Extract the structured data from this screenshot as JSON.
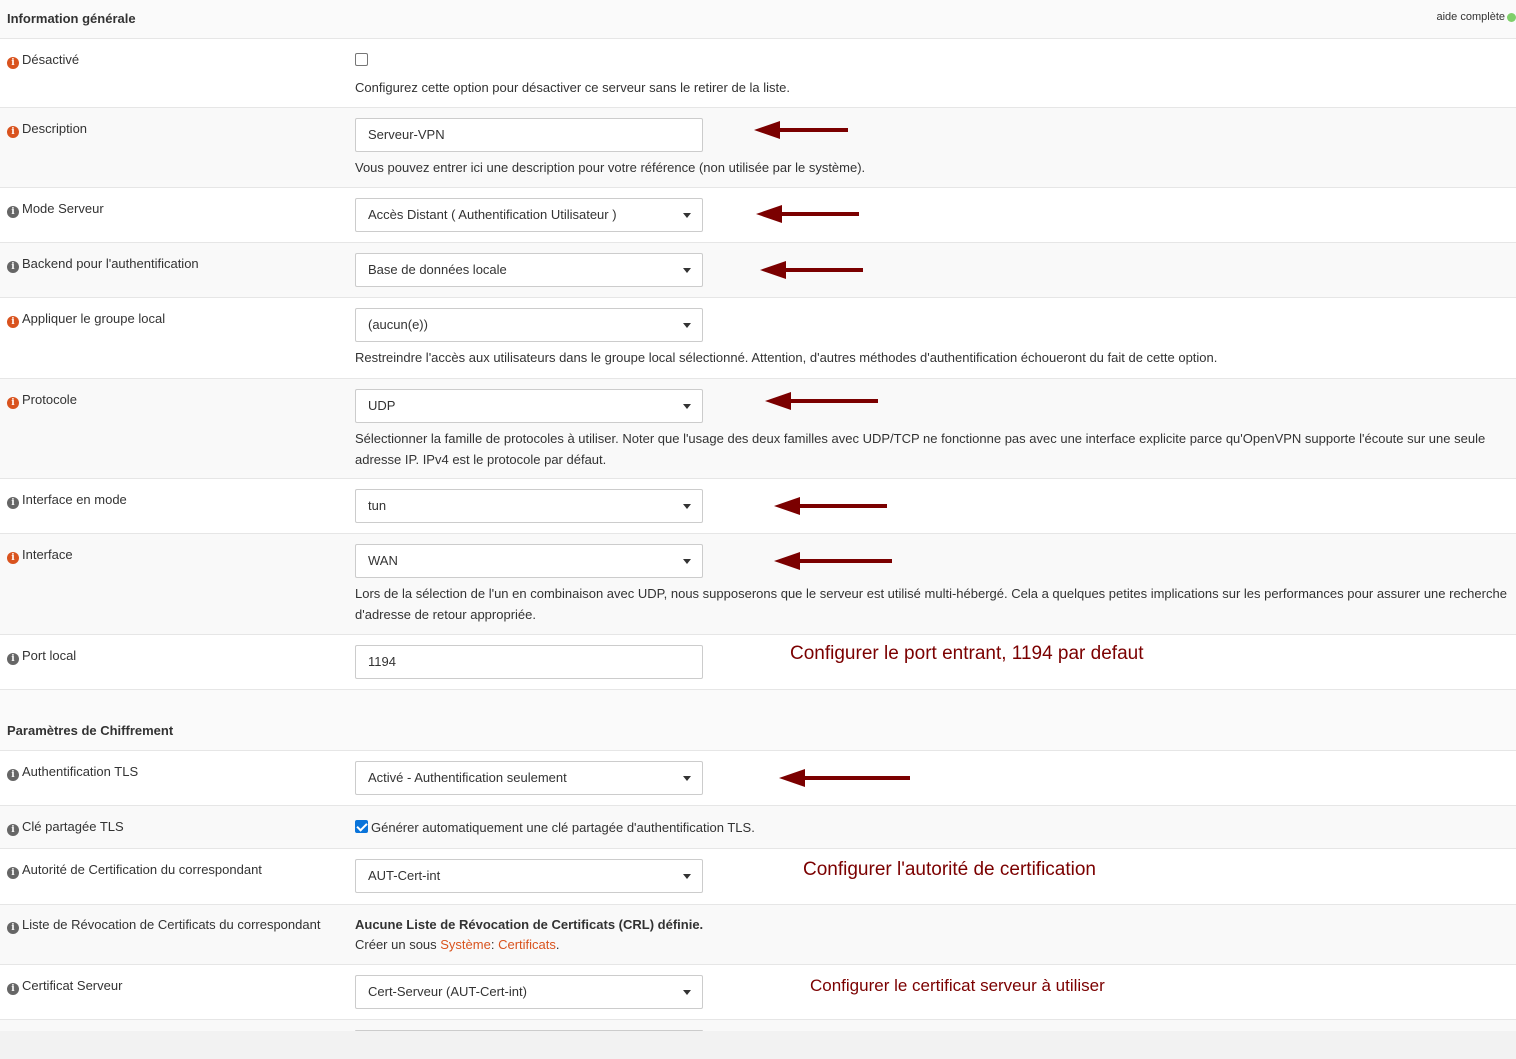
{
  "section1": {
    "title": "Information générale",
    "help_toggle": "aide complète"
  },
  "section2": {
    "title": "Paramètres de Chiffrement"
  },
  "rows": {
    "disabled": {
      "label": "Désactivé",
      "help": "Configurez cette option pour désactiver ce serveur sans le retirer de la liste."
    },
    "description": {
      "label": "Description",
      "value": "Serveur-VPN",
      "help": "Vous pouvez entrer ici une description pour votre référence (non utilisée par le système)."
    },
    "server_mode": {
      "label": "Mode Serveur",
      "value": "Accès Distant ( Authentification Utilisateur )"
    },
    "auth_backend": {
      "label": "Backend pour l'authentification",
      "value": "Base de données locale"
    },
    "local_group": {
      "label": "Appliquer le groupe local",
      "value": "(aucun(e))",
      "help": "Restreindre l'accès aux utilisateurs dans le groupe local sélectionné. Attention, d'autres méthodes d'authentification échoueront du fait de cette option."
    },
    "protocol": {
      "label": "Protocole",
      "value": "UDP",
      "help_line1": "Sélectionner la famille de protocoles à utiliser. Noter que l'usage des deux familles avec UDP/TCP ne fonctionne pas avec une interface explicite parce qu'OpenVPN supporte l'écoute sur une seule",
      "help_line2": "adresse IP. IPv4 est le protocole par défaut."
    },
    "dev_mode": {
      "label": "Interface en mode",
      "value": "tun"
    },
    "interface": {
      "label": "Interface",
      "value": "WAN",
      "help_line1": "Lors de la sélection de l'un en combinaison avec UDP, nous supposerons que le serveur est utilisé multi-hébergé. Cela a quelques petites implications sur les performances pour assurer une recherche",
      "help_line2": "d'adresse de retour appropriée."
    },
    "local_port": {
      "label": "Port local",
      "value": "1194"
    },
    "tls_auth": {
      "label": "Authentification TLS",
      "value": "Activé - Authentification seulement"
    },
    "tls_key": {
      "label": "Clé partagée TLS",
      "checkbox_label": "Générer automatiquement une clé partagée d'authentification TLS."
    },
    "peer_ca": {
      "label": "Autorité de Certification du correspondant",
      "value": "AUT-Cert-int"
    },
    "peer_crl": {
      "label": "Liste de Révocation de Certificats du correspondant",
      "text_bold": "Aucune Liste de Révocation de Certificats (CRL) définie.",
      "text_prefix": "Créer un sous ",
      "link1": "Système",
      "link_sep": ": ",
      "link2": "Certificats",
      "text_suffix": "."
    },
    "server_cert": {
      "label": "Certificat Serveur",
      "value": "Cert-Serveur (AUT-Cert-int)"
    }
  },
  "annotations": {
    "port": "Configurer le port entrant, 1194 par defaut",
    "ca": "Configurer l'autorité de certification",
    "cert": "Configurer le certificat serveur à utiliser"
  },
  "colors": {
    "annotation": "#7b0000",
    "info_orange": "#d9531e",
    "info_gray": "#666666",
    "link": "#d9531e"
  }
}
